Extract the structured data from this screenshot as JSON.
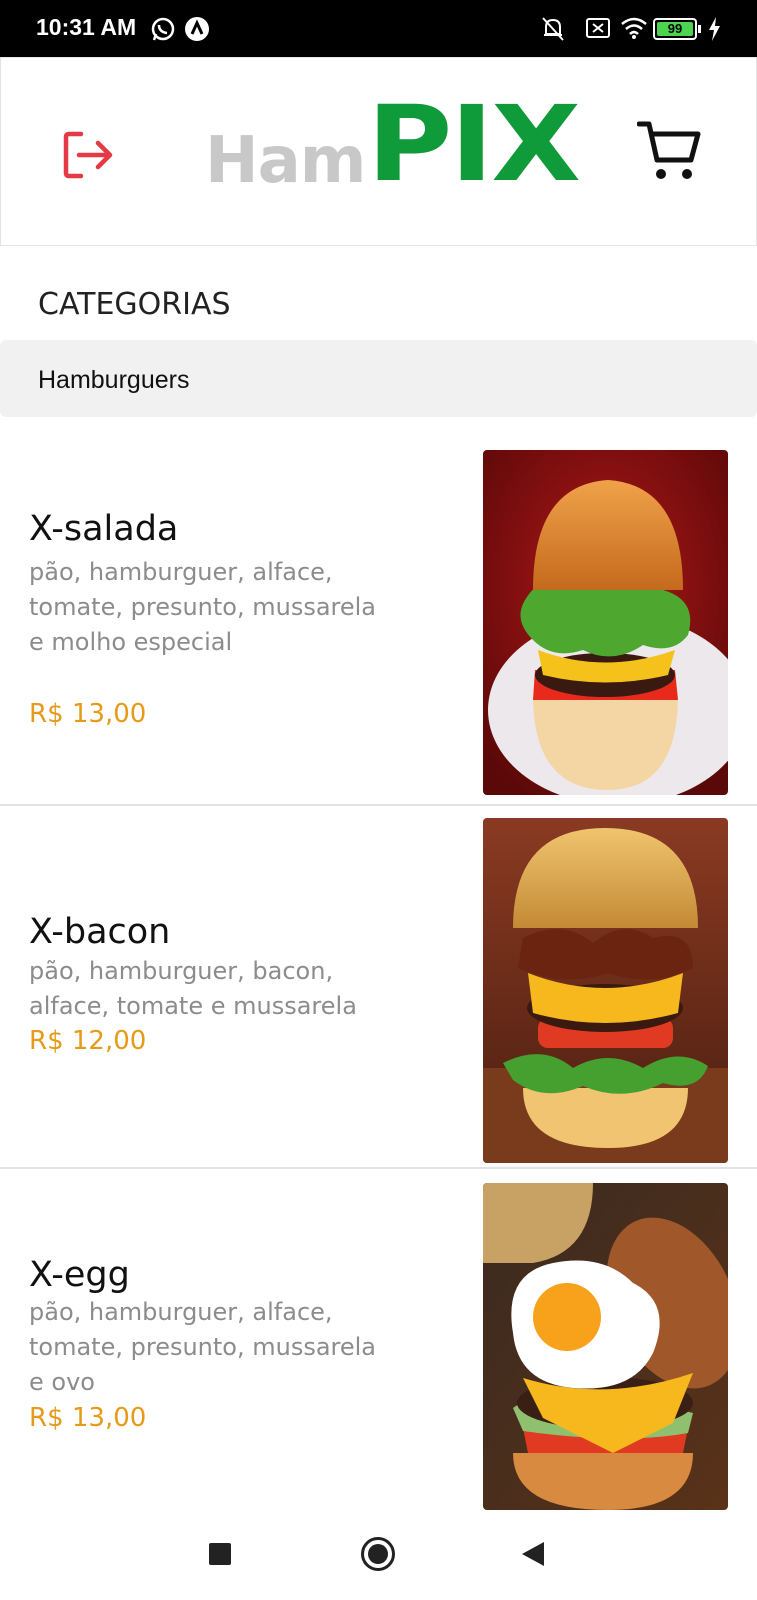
{
  "status_bar": {
    "time": "10:31 AM",
    "battery": "99",
    "icons": [
      "whatsapp-icon",
      "app-notification-icon",
      "mute-bell-icon",
      "sim-blocked-icon",
      "wifi-icon",
      "battery-icon",
      "charging-icon"
    ]
  },
  "header": {
    "logo_part1": "Ham",
    "logo_part2": "PIX",
    "logout_icon": "logout-icon",
    "cart_icon": "cart-icon",
    "colors": {
      "logout": "#e53946",
      "logo_green": "#0f9b3a",
      "logo_grey": "#c8c8c8"
    }
  },
  "categories": {
    "title": "CATEGORIAS",
    "selected": "Hamburguers"
  },
  "products": [
    {
      "name": "X-salada",
      "description": "pão, hamburguer, alface, tomate, presunto, mussarela e molho especial",
      "price": "R$ 13,00"
    },
    {
      "name": "X-bacon",
      "description": "pão, hamburguer, bacon, alface, tomate e mussarela",
      "price": "R$ 12,00"
    },
    {
      "name": "X-egg",
      "description": "pão, hamburguer, alface, tomate, presunto, mussarela e ovo",
      "price": "R$ 13,00"
    }
  ],
  "colors": {
    "price": "#e69a19",
    "description": "#8c8c8c"
  },
  "nav_bar": {
    "icons": [
      "recents-square-icon",
      "home-circle-icon",
      "back-triangle-icon"
    ]
  }
}
